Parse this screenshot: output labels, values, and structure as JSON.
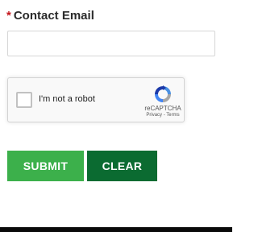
{
  "form": {
    "email_label": "Contact Email",
    "required_marker": "*",
    "email_value": "",
    "email_placeholder": ""
  },
  "recaptcha": {
    "checkbox_label": "I'm not a robot",
    "brand": "reCAPTCHA",
    "privacy_link": "Privacy",
    "separator": " - ",
    "terms_link": "Terms",
    "logo_icon": "recaptcha-logo-icon"
  },
  "buttons": {
    "submit_label": "SUBMIT",
    "clear_label": "CLEAR"
  },
  "colors": {
    "required": "#c4161c",
    "submit_bg": "#3cb04b",
    "clear_bg": "#0b6b31",
    "bottom_bar": "#0a0a0a"
  }
}
